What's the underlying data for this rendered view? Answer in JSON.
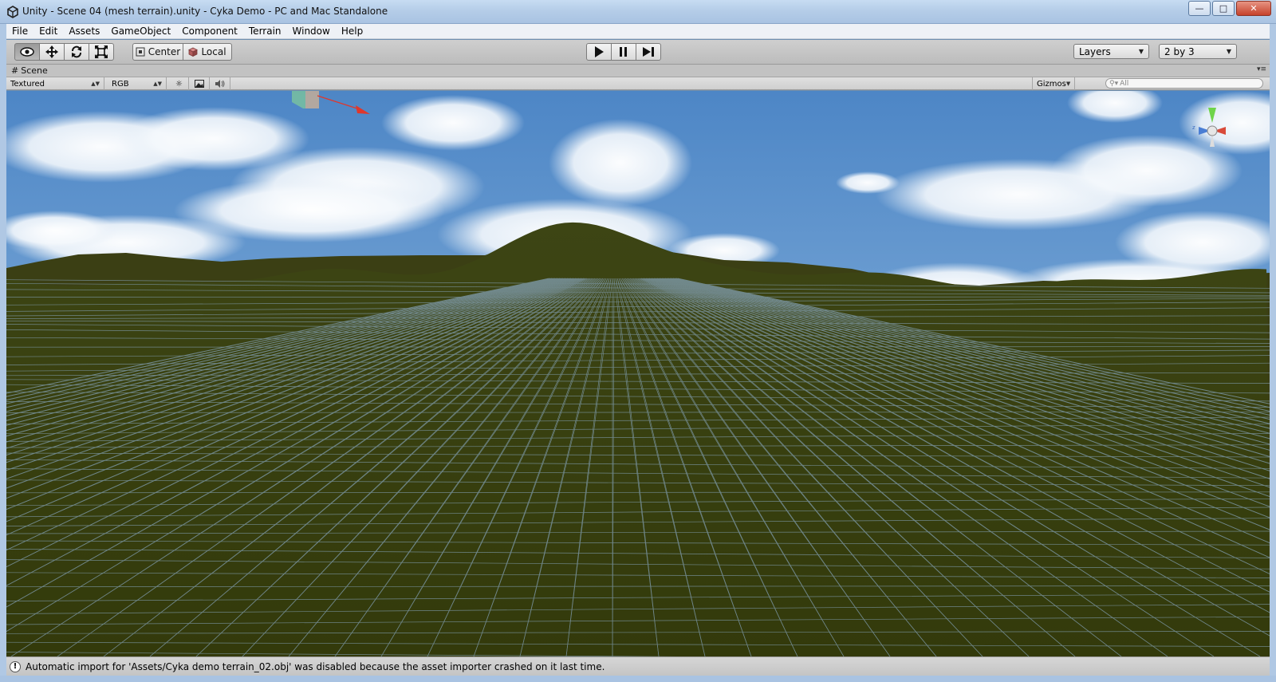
{
  "window": {
    "title": "Unity - Scene 04 (mesh terrain).unity - Cyka Demo - PC and Mac Standalone",
    "icons": {
      "app": "unity-logo-icon",
      "minimize": "minimize-icon",
      "maximize": "maximize-icon",
      "close": "close-icon"
    }
  },
  "menu": [
    "File",
    "Edit",
    "Assets",
    "GameObject",
    "Component",
    "Terrain",
    "Window",
    "Help"
  ],
  "toolbar": {
    "transform_tools": [
      "view-hand-icon",
      "move-icon",
      "rotate-icon",
      "scale-icon"
    ],
    "active_tool": "view-hand-icon",
    "pivot_label": "Center",
    "space_label": "Local",
    "play_controls": [
      "play-icon",
      "pause-icon",
      "step-icon"
    ],
    "layers_label": "Layers",
    "layout_label": "2 by 3"
  },
  "scene": {
    "tab_label": "Scene",
    "render_mode": "Textured",
    "channel": "RGB",
    "toggles": [
      "lighting-icon",
      "image-effects-icon",
      "audio-icon"
    ],
    "gizmos_label": "Gizmos",
    "search_placeholder": "All",
    "colors": {
      "terrain": "#333a0c",
      "wire": "#8aa7c0",
      "sky": "#6a9bd0"
    }
  },
  "status": {
    "message": "Automatic import for 'Assets/Cyka demo terrain_02.obj' was disabled because the asset importer crashed on it last time."
  }
}
